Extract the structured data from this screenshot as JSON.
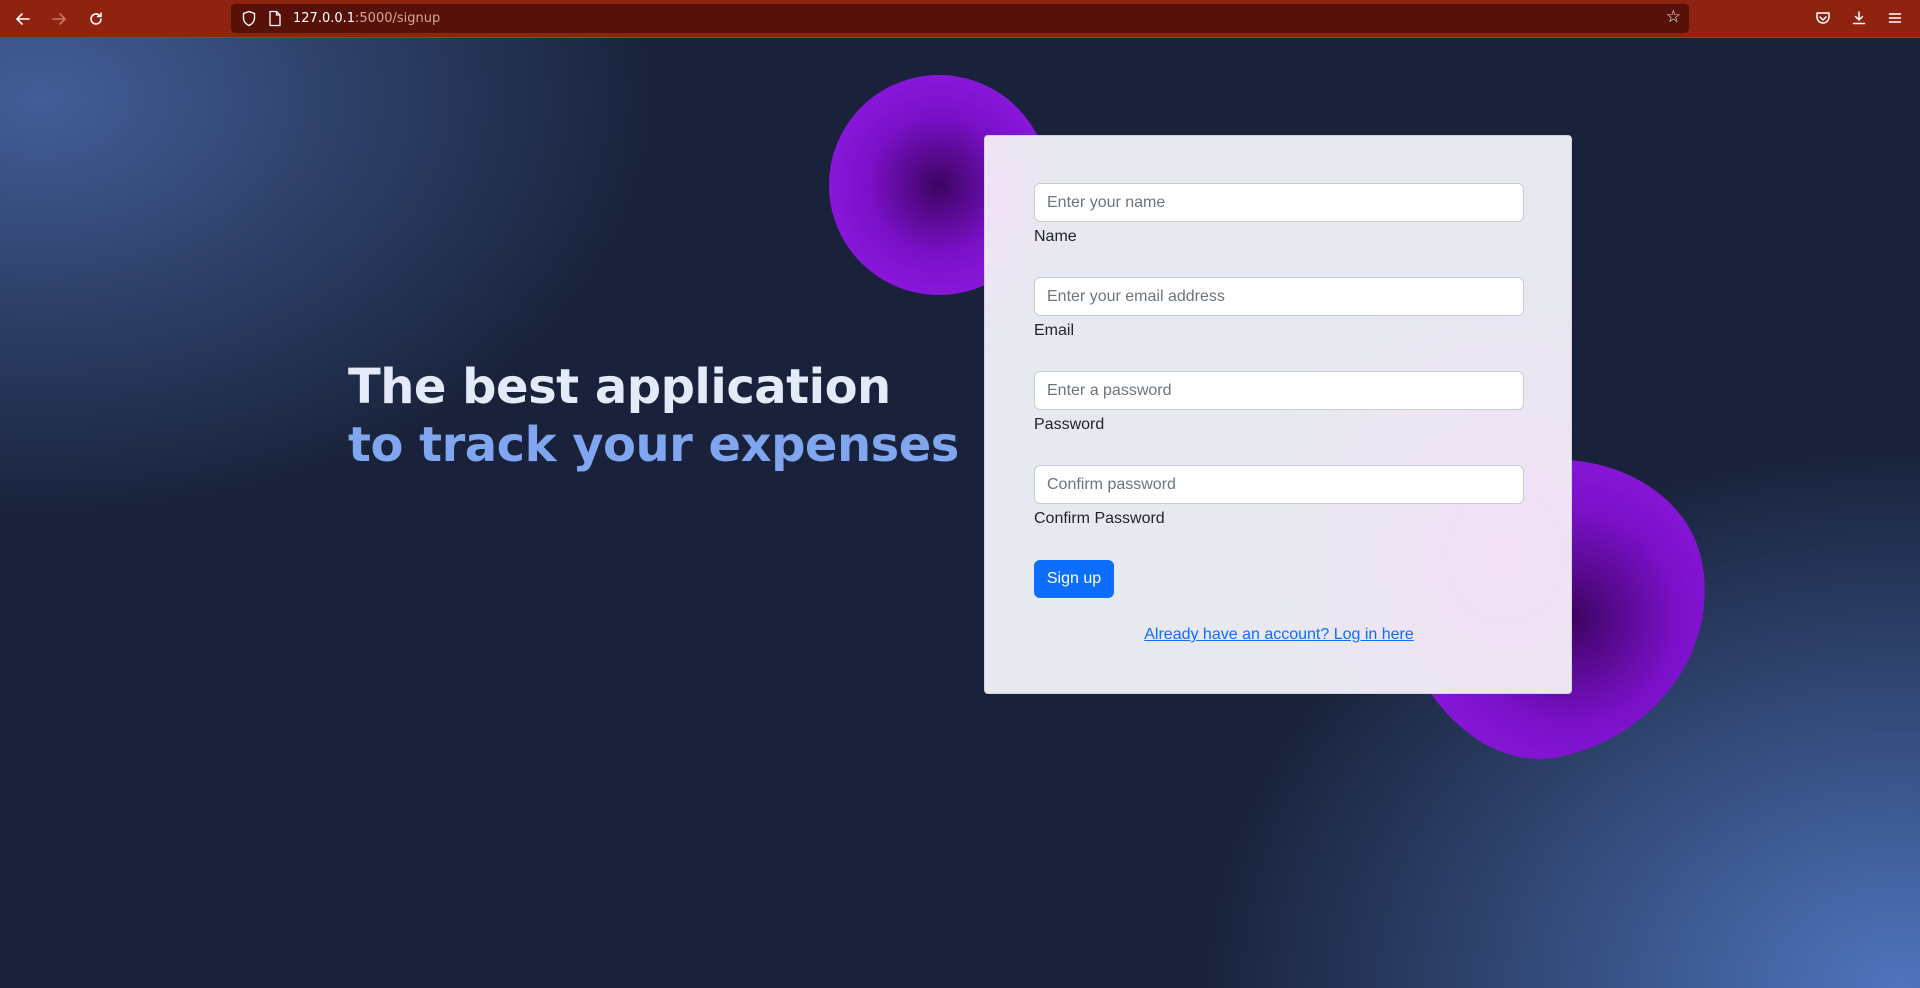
{
  "browser": {
    "url_host": "127.0.0.1",
    "url_path": ":5000/signup",
    "icons": {
      "back": "arrow-left-icon",
      "forward": "arrow-right-icon",
      "reload": "reload-icon",
      "shield": "shield-icon",
      "page": "page-icon",
      "bookmark": "star-icon",
      "pocket": "pocket-icon",
      "downloads": "download-icon",
      "menu": "hamburger-menu-icon"
    },
    "colors": {
      "toolbar": "#8f230f",
      "urlbar": "#581108"
    }
  },
  "hero": {
    "line1": "The best application",
    "line2": "to track your expenses"
  },
  "form": {
    "name": {
      "placeholder": "Enter your name",
      "label": "Name",
      "value": ""
    },
    "email": {
      "placeholder": "Enter your email address",
      "label": "Email",
      "value": ""
    },
    "password": {
      "placeholder": "Enter a password",
      "label": "Password",
      "value": ""
    },
    "confirm": {
      "placeholder": "Confirm password",
      "label": "Confirm Password",
      "value": ""
    },
    "submit_label": "Sign up",
    "login_link": "Already have an account? Log in here"
  },
  "colors": {
    "accent": "#0d6efd",
    "hero_primary": "#e4eaf7",
    "hero_secondary": "#7fa6ef",
    "blob": "#9b1ff0"
  }
}
